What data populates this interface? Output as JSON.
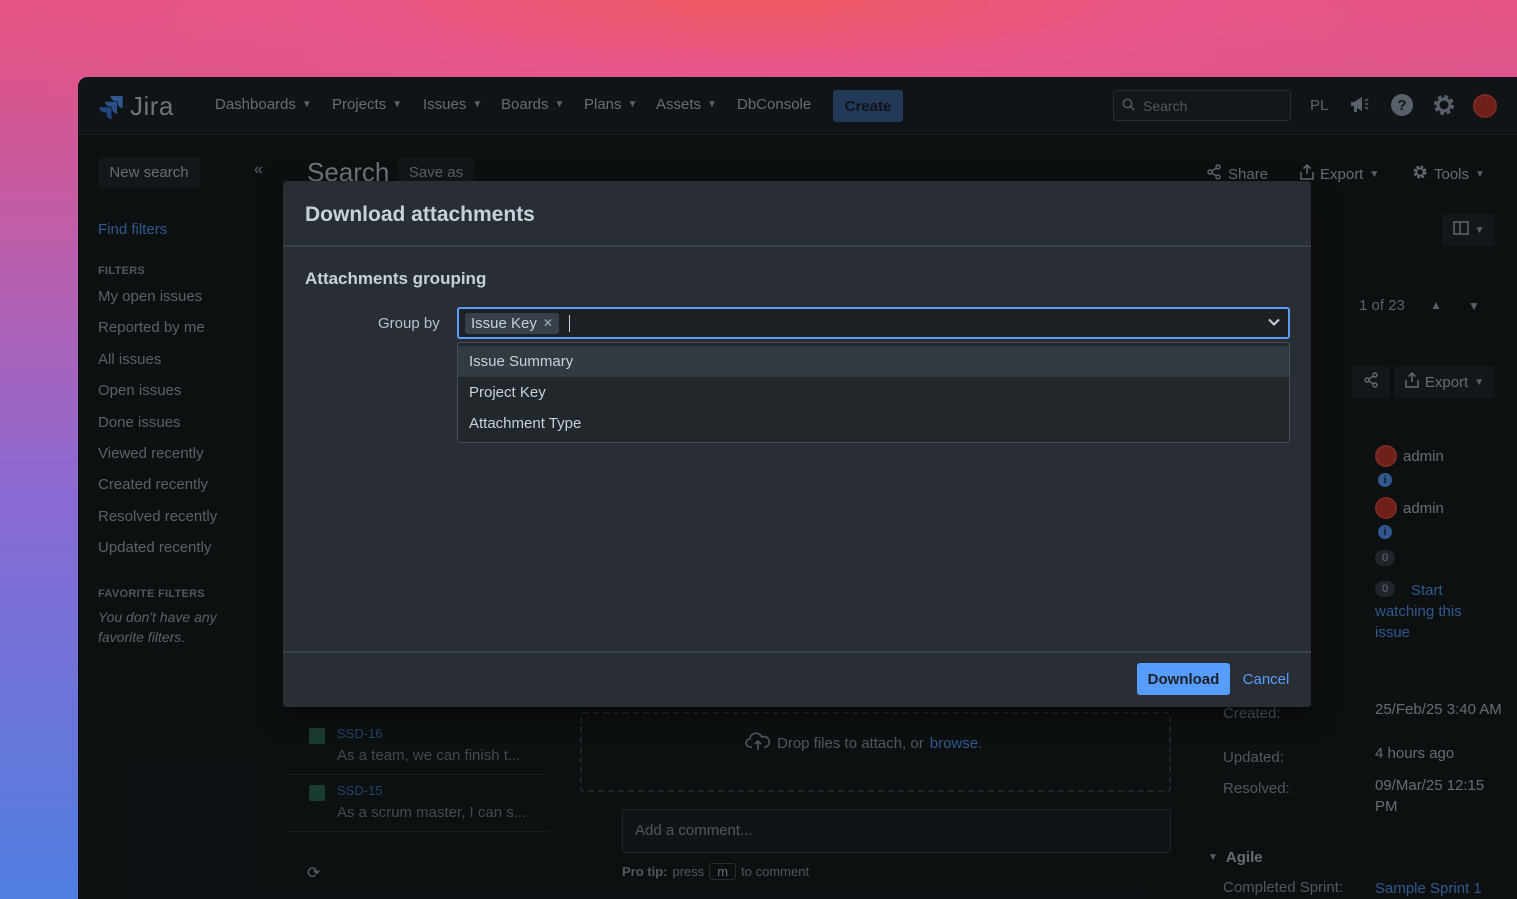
{
  "topnav": {
    "logo_text": "Jira",
    "items": [
      {
        "label": "Dashboards"
      },
      {
        "label": "Projects"
      },
      {
        "label": "Issues"
      },
      {
        "label": "Boards"
      },
      {
        "label": "Plans"
      },
      {
        "label": "Assets"
      },
      {
        "label": "DbConsole"
      }
    ],
    "create_label": "Create",
    "search_placeholder": "Search",
    "user_initials": "PL"
  },
  "sidebar": {
    "new_search": "New search",
    "find_filters": "Find filters",
    "filters_heading": "FILTERS",
    "filters": [
      "My open issues",
      "Reported by me",
      "All issues",
      "Open issues",
      "Done issues",
      "Viewed recently",
      "Created recently",
      "Resolved recently",
      "Updated recently"
    ],
    "favorites_heading": "FAVORITE FILTERS",
    "favorites_empty": "You don't have any favorite filters."
  },
  "main": {
    "title": "Search",
    "save_as": "Save as",
    "share": "Share",
    "export": "Export",
    "tools": "Tools",
    "pager": "1 of 23",
    "issue_list": [
      {
        "key": "SSD-16",
        "summary": "As a team, we can finish t..."
      },
      {
        "key": "SSD-15",
        "summary": "As a scrum master, I can s..."
      }
    ],
    "dropzone_text": "Drop files to attach, or",
    "dropzone_link": "browse.",
    "comment_placeholder": "Add a comment...",
    "protip_label": "Pro tip:",
    "protip_press": "press",
    "protip_key": "m",
    "protip_suffix": "to comment"
  },
  "details": {
    "export": "Export",
    "assignee": "admin",
    "reporter": "admin",
    "votes": "0",
    "watchers": "0",
    "watch_link": "Start watching this issue",
    "created_label": "Created:",
    "created_value": "25/Feb/25 3:40 AM",
    "updated_label": "Updated:",
    "updated_value": "4 hours ago",
    "resolved_label": "Resolved:",
    "resolved_value": "09/Mar/25 12:15 PM",
    "agile_heading": "Agile",
    "sprint_label": "Completed Sprint:",
    "sprint_value": "Sample Sprint 1"
  },
  "modal": {
    "title": "Download attachments",
    "section_title": "Attachments grouping",
    "group_by_label": "Group by",
    "selected_chip": "Issue Key",
    "options": [
      "Issue Summary",
      "Project Key",
      "Attachment Type"
    ],
    "download_label": "Download",
    "cancel_label": "Cancel"
  },
  "colors": {
    "accent": "#579dff",
    "modal_bg": "#282e33",
    "page_bg": "#161a1d"
  }
}
